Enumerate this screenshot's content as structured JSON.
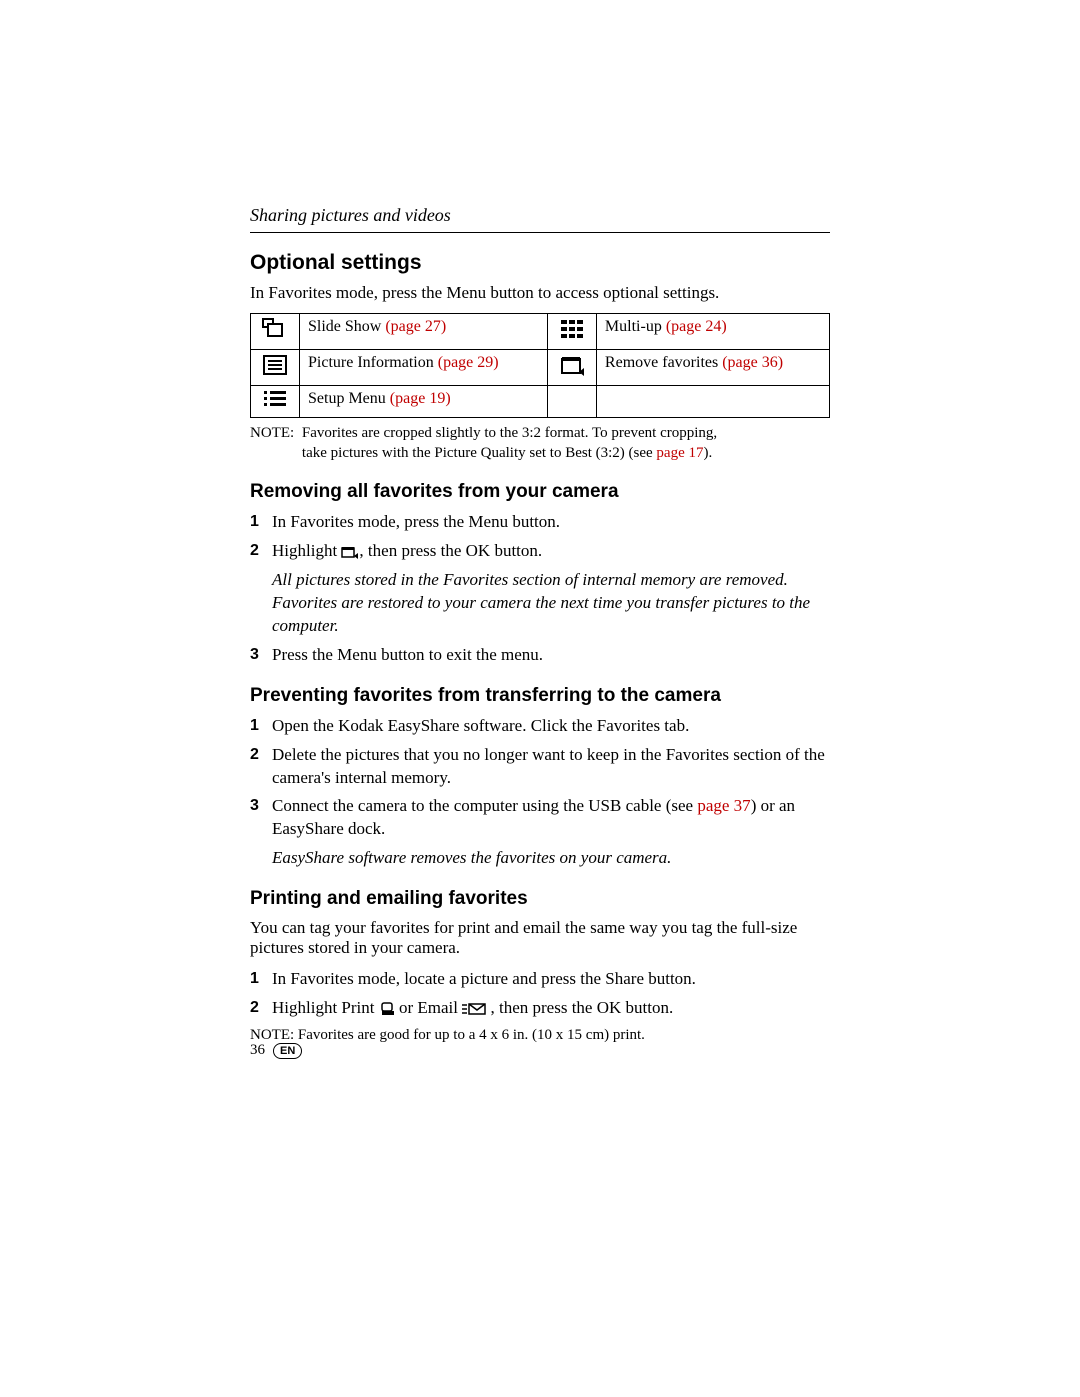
{
  "header": {
    "running": "Sharing pictures and videos"
  },
  "section1": {
    "title": "Optional settings",
    "intro": "In Favorites mode, press the Menu button to access optional settings.",
    "rows": [
      {
        "left": "Slide Show",
        "leftLink": "(page 27)",
        "right": "Multi-up",
        "rightLink": "(page 24)"
      },
      {
        "left": "Picture Information",
        "leftLink": "(page 29)",
        "right": "Remove favorites",
        "rightLink": "(page 36)"
      },
      {
        "left": "Setup Menu",
        "leftLink": "(page 19)",
        "right": "",
        "rightLink": ""
      }
    ],
    "noteLabel": "NOTE:",
    "noteBody1": "Favorites are cropped slightly to the 3:2 format. To prevent cropping, take pictures with the Picture Quality set to Best (3:2) (see ",
    "noteLink": "page 17",
    "noteBody2": ")."
  },
  "section2": {
    "title": "Removing all favorites from your camera",
    "step1": "In Favorites mode, press the Menu button.",
    "step2a": "Highlight ",
    "step2b": ", then press the OK button.",
    "result": "All pictures stored in the Favorites section of internal memory are removed. Favorites are restored to your camera the next time you transfer pictures to the computer.",
    "step3": "Press the Menu button to exit the menu."
  },
  "section3": {
    "title": "Preventing favorites from transferring to the camera",
    "step1": "Open the Kodak EasyShare software. Click the Favorites tab.",
    "step2": "Delete the pictures that you no longer want to keep in the Favorites section of the camera's internal memory.",
    "step3a": "Connect the camera to the computer using the USB cable (see ",
    "step3link": "page 37",
    "step3b": ") or an EasyShare dock.",
    "result": "EasyShare software removes the favorites on your camera."
  },
  "section4": {
    "title": "Printing and emailing favorites",
    "intro": "You can tag your favorites for print and email the same way you tag the full-size pictures stored in your camera.",
    "step1": "In Favorites mode, locate a picture and press the Share button.",
    "step2a": "Highlight Print ",
    "step2b": " or Email ",
    "step2c": ", then press the OK button.",
    "noteLabel": "NOTE:",
    "noteBody": "Favorites are good for up to a 4 x 6 in. (10 x 15 cm) print."
  },
  "footer": {
    "page": "36",
    "lang": "EN"
  }
}
